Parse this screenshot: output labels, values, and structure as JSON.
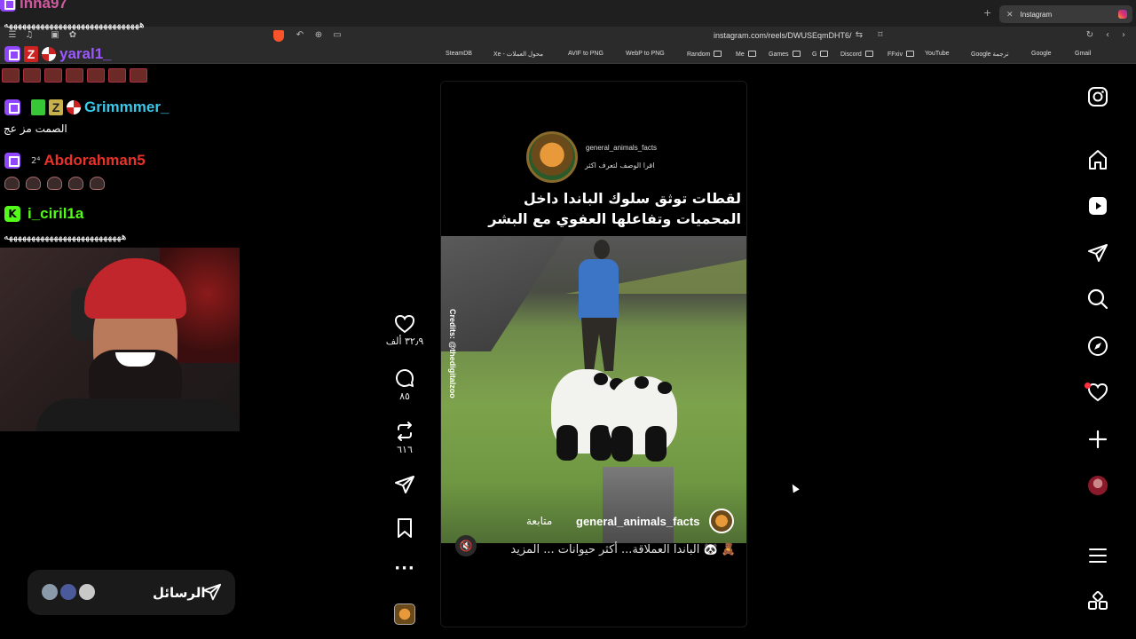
{
  "browser": {
    "tab_title": "Instagram",
    "url": "instagram.com/reels/DWUSEqmDHT6/",
    "bookmarks": [
      "SteamDB",
      "Xe - محول العملات",
      "AVIF to PNG",
      "WebP to PNG",
      "Random",
      "Me",
      "Games",
      "G",
      "Discord",
      "FFxiv",
      "YouTube",
      "Google ترجمة",
      "Google",
      "Gmail"
    ]
  },
  "chat": {
    "top_user": "inna97",
    "top_msg": "ههههههههههههههههههههههههههههههه",
    "messages": [
      {
        "platform": "twitch",
        "user": "yaral1_",
        "user_color": "#9b59ff",
        "text": ""
      },
      {
        "platform": "twitch",
        "user": "Grimmmer_",
        "user_color": "#3cc6e8",
        "text": "الصمت مز عج"
      },
      {
        "platform": "twitch",
        "user": "Abdorahman5",
        "user_color": "#e8322a",
        "text": ""
      },
      {
        "platform": "kick",
        "user": "i_ciril1a",
        "user_color": "#53fc18",
        "text": "ههههههههههههههههههههههههههه"
      }
    ]
  },
  "messages_pill": {
    "label": "الرسائل"
  },
  "reel": {
    "account": "general_animals_facts",
    "account_sub": "اقرا الوصف لتعرف اكثر",
    "title_line1": "لقطات توثق سلوك الباندا داخل",
    "title_line2": "المحميات وتفاعلها العفوي مع البشر",
    "credits": "Credits: @thedigitalzoo",
    "follow": "متابعة",
    "caption": "🧸 🐼 الباندا العملاقة... أكثر حيوانات ... المزيد"
  },
  "actions": {
    "likes": "٣٢٫٩ ألف",
    "comments": "٨٥",
    "reposts": "٦١٦"
  },
  "nav_icons": [
    "instagram-icon",
    "home-icon",
    "reels-icon",
    "send-icon",
    "search-icon",
    "explore-icon",
    "heart-icon",
    "create-icon",
    "profile-avatar",
    "menu-icon",
    "apps-icon"
  ],
  "colors": {
    "notification": "#ff3040",
    "twitch": "#9146ff",
    "kick": "#53fc18"
  }
}
